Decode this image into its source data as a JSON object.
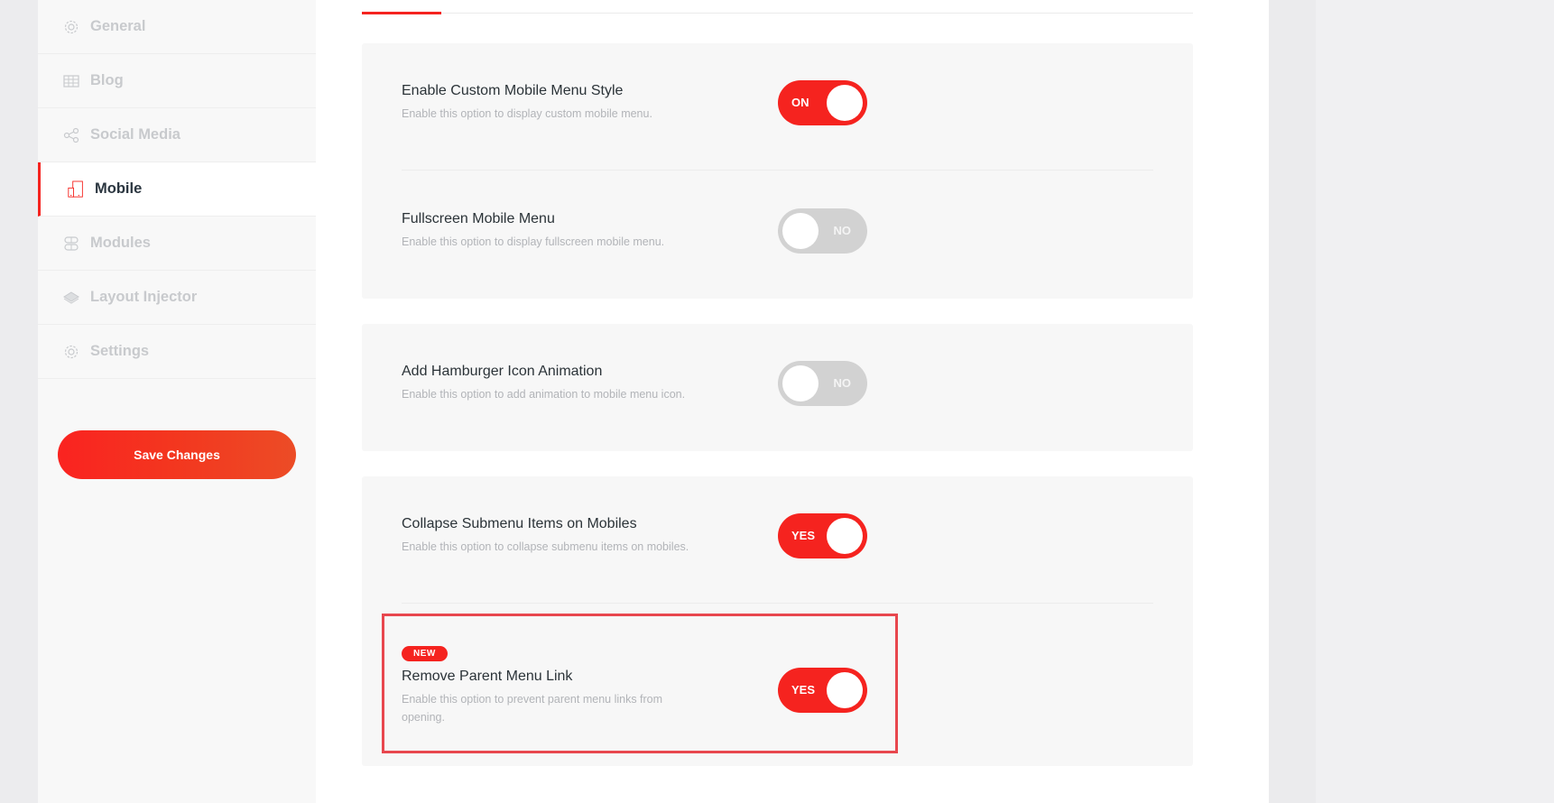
{
  "sidebar": {
    "items": [
      {
        "label": "General",
        "icon": "gear-icon",
        "active": false
      },
      {
        "label": "Blog",
        "icon": "blog-grid-icon",
        "active": false
      },
      {
        "label": "Social Media",
        "icon": "share-icon",
        "active": false
      },
      {
        "label": "Mobile",
        "icon": "mobile-tablet-icon",
        "active": true
      },
      {
        "label": "Modules",
        "icon": "modules-icon",
        "active": false
      },
      {
        "label": "Layout Injector",
        "icon": "layers-icon",
        "active": false
      },
      {
        "label": "Settings",
        "icon": "gear-icon",
        "active": false
      }
    ],
    "save_label": "Save Changes"
  },
  "colors": {
    "accent": "#f5231f",
    "toggle_off": "#d2d2d2",
    "highlight_border": "#e8474e"
  },
  "cards": [
    {
      "options": [
        {
          "title": "Enable Custom Mobile Menu Style",
          "description": "Enable this option to display custom mobile menu.",
          "state": "ON",
          "enabled": true
        },
        {
          "title": "Fullscreen Mobile Menu",
          "description": "Enable this option to display fullscreen mobile menu.",
          "state": "NO",
          "enabled": false
        }
      ]
    },
    {
      "options": [
        {
          "title": "Add Hamburger Icon Animation",
          "description": "Enable this option to add animation to mobile menu icon.",
          "state": "NO",
          "enabled": false
        }
      ]
    },
    {
      "options": [
        {
          "title": "Collapse Submenu Items on Mobiles",
          "description": "Enable this option to collapse submenu items on mobiles.",
          "state": "YES",
          "enabled": true
        },
        {
          "badge": "NEW",
          "title": "Remove Parent Menu Link",
          "description": "Enable this option to prevent parent menu links from opening.",
          "state": "YES",
          "enabled": true
        }
      ]
    }
  ]
}
